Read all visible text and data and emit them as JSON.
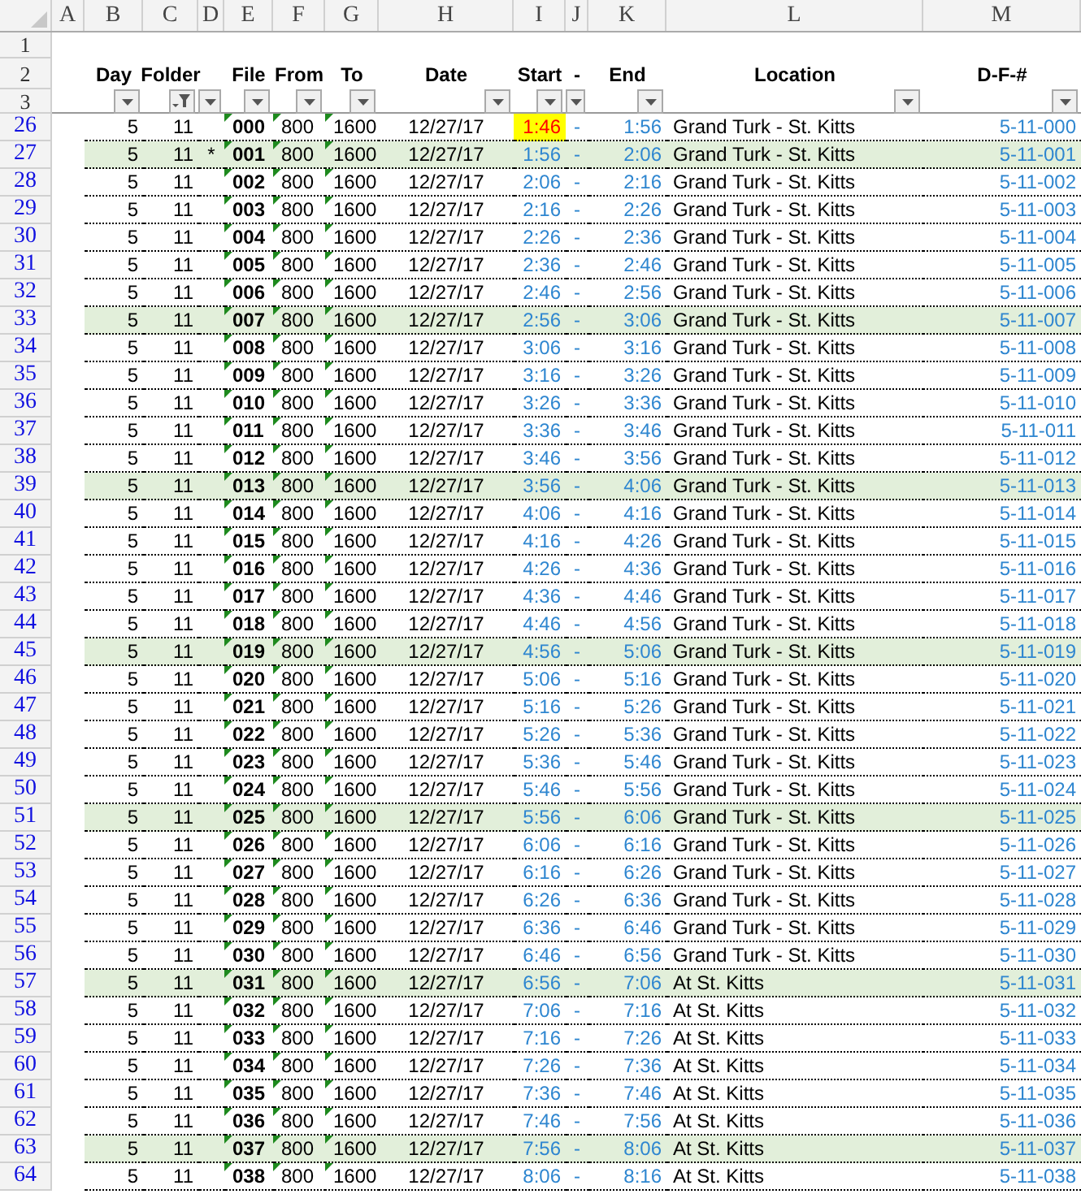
{
  "column_letters": [
    "A",
    "B",
    "C",
    "D",
    "E",
    "F",
    "G",
    "H",
    "I",
    "J",
    "K",
    "L",
    "M"
  ],
  "header_row_numbers": [
    "1",
    "2",
    "3"
  ],
  "headers": [
    {
      "label": "Day",
      "filtered": false
    },
    {
      "label": "Folder",
      "filtered": true
    },
    {
      "filtered": false
    },
    {
      "label": "File",
      "filtered": false
    },
    {
      "label": "From",
      "filtered": false
    },
    {
      "label": "To",
      "filtered": false
    },
    {
      "label": "Date",
      "filtered": false
    },
    {
      "label": "Start",
      "filtered": false
    },
    {
      "label": "-",
      "filtered": false
    },
    {
      "label": "End",
      "filtered": false
    },
    {
      "label": "Location",
      "filtered": false
    },
    {
      "label": "D-F-#",
      "filtered": false
    }
  ],
  "rows": [
    {
      "row": "26",
      "day": "5",
      "folder": "11",
      "file": "000",
      "from": "800",
      "to": "1600",
      "date": "12/27/17",
      "start": "1:46",
      "dash": "-",
      "end": "1:56",
      "location": "Grand Turk - St. Kitts",
      "dfn": "5-11-000",
      "highlighted": false,
      "start_flagged": true
    },
    {
      "row": "27",
      "day": "5",
      "folder": "11",
      "mark": "*",
      "file": "001",
      "from": "800",
      "to": "1600",
      "date": "12/27/17",
      "start": "1:56",
      "dash": "-",
      "end": "2:06",
      "location": "Grand Turk - St. Kitts",
      "dfn": "5-11-001",
      "highlighted": true,
      "start_flagged": false
    },
    {
      "row": "28",
      "day": "5",
      "folder": "11",
      "file": "002",
      "from": "800",
      "to": "1600",
      "date": "12/27/17",
      "start": "2:06",
      "dash": "-",
      "end": "2:16",
      "location": "Grand Turk - St. Kitts",
      "dfn": "5-11-002",
      "highlighted": false,
      "start_flagged": false
    },
    {
      "row": "29",
      "day": "5",
      "folder": "11",
      "file": "003",
      "from": "800",
      "to": "1600",
      "date": "12/27/17",
      "start": "2:16",
      "dash": "-",
      "end": "2:26",
      "location": "Grand Turk - St. Kitts",
      "dfn": "5-11-003",
      "highlighted": false,
      "start_flagged": false
    },
    {
      "row": "30",
      "day": "5",
      "folder": "11",
      "file": "004",
      "from": "800",
      "to": "1600",
      "date": "12/27/17",
      "start": "2:26",
      "dash": "-",
      "end": "2:36",
      "location": "Grand Turk - St. Kitts",
      "dfn": "5-11-004",
      "highlighted": false,
      "start_flagged": false
    },
    {
      "row": "31",
      "day": "5",
      "folder": "11",
      "file": "005",
      "from": "800",
      "to": "1600",
      "date": "12/27/17",
      "start": "2:36",
      "dash": "-",
      "end": "2:46",
      "location": "Grand Turk - St. Kitts",
      "dfn": "5-11-005",
      "highlighted": false,
      "start_flagged": false
    },
    {
      "row": "32",
      "day": "5",
      "folder": "11",
      "file": "006",
      "from": "800",
      "to": "1600",
      "date": "12/27/17",
      "start": "2:46",
      "dash": "-",
      "end": "2:56",
      "location": "Grand Turk - St. Kitts",
      "dfn": "5-11-006",
      "highlighted": false,
      "start_flagged": false
    },
    {
      "row": "33",
      "day": "5",
      "folder": "11",
      "file": "007",
      "from": "800",
      "to": "1600",
      "date": "12/27/17",
      "start": "2:56",
      "dash": "-",
      "end": "3:06",
      "location": "Grand Turk - St. Kitts",
      "dfn": "5-11-007",
      "highlighted": true,
      "start_flagged": false
    },
    {
      "row": "34",
      "day": "5",
      "folder": "11",
      "file": "008",
      "from": "800",
      "to": "1600",
      "date": "12/27/17",
      "start": "3:06",
      "dash": "-",
      "end": "3:16",
      "location": "Grand Turk - St. Kitts",
      "dfn": "5-11-008",
      "highlighted": false,
      "start_flagged": false
    },
    {
      "row": "35",
      "day": "5",
      "folder": "11",
      "file": "009",
      "from": "800",
      "to": "1600",
      "date": "12/27/17",
      "start": "3:16",
      "dash": "-",
      "end": "3:26",
      "location": "Grand Turk - St. Kitts",
      "dfn": "5-11-009",
      "highlighted": false,
      "start_flagged": false
    },
    {
      "row": "36",
      "day": "5",
      "folder": "11",
      "file": "010",
      "from": "800",
      "to": "1600",
      "date": "12/27/17",
      "start": "3:26",
      "dash": "-",
      "end": "3:36",
      "location": "Grand Turk - St. Kitts",
      "dfn": "5-11-010",
      "highlighted": false,
      "start_flagged": false
    },
    {
      "row": "37",
      "day": "5",
      "folder": "11",
      "file": "011",
      "from": "800",
      "to": "1600",
      "date": "12/27/17",
      "start": "3:36",
      "dash": "-",
      "end": "3:46",
      "location": "Grand Turk - St. Kitts",
      "dfn": "5-11-011",
      "highlighted": false,
      "start_flagged": false
    },
    {
      "row": "38",
      "day": "5",
      "folder": "11",
      "file": "012",
      "from": "800",
      "to": "1600",
      "date": "12/27/17",
      "start": "3:46",
      "dash": "-",
      "end": "3:56",
      "location": "Grand Turk - St. Kitts",
      "dfn": "5-11-012",
      "highlighted": false,
      "start_flagged": false
    },
    {
      "row": "39",
      "day": "5",
      "folder": "11",
      "file": "013",
      "from": "800",
      "to": "1600",
      "date": "12/27/17",
      "start": "3:56",
      "dash": "-",
      "end": "4:06",
      "location": "Grand Turk - St. Kitts",
      "dfn": "5-11-013",
      "highlighted": true,
      "start_flagged": false
    },
    {
      "row": "40",
      "day": "5",
      "folder": "11",
      "file": "014",
      "from": "800",
      "to": "1600",
      "date": "12/27/17",
      "start": "4:06",
      "dash": "-",
      "end": "4:16",
      "location": "Grand Turk - St. Kitts",
      "dfn": "5-11-014",
      "highlighted": false,
      "start_flagged": false
    },
    {
      "row": "41",
      "day": "5",
      "folder": "11",
      "file": "015",
      "from": "800",
      "to": "1600",
      "date": "12/27/17",
      "start": "4:16",
      "dash": "-",
      "end": "4:26",
      "location": "Grand Turk - St. Kitts",
      "dfn": "5-11-015",
      "highlighted": false,
      "start_flagged": false
    },
    {
      "row": "42",
      "day": "5",
      "folder": "11",
      "file": "016",
      "from": "800",
      "to": "1600",
      "date": "12/27/17",
      "start": "4:26",
      "dash": "-",
      "end": "4:36",
      "location": "Grand Turk - St. Kitts",
      "dfn": "5-11-016",
      "highlighted": false,
      "start_flagged": false
    },
    {
      "row": "43",
      "day": "5",
      "folder": "11",
      "file": "017",
      "from": "800",
      "to": "1600",
      "date": "12/27/17",
      "start": "4:36",
      "dash": "-",
      "end": "4:46",
      "location": "Grand Turk - St. Kitts",
      "dfn": "5-11-017",
      "highlighted": false,
      "start_flagged": false
    },
    {
      "row": "44",
      "day": "5",
      "folder": "11",
      "file": "018",
      "from": "800",
      "to": "1600",
      "date": "12/27/17",
      "start": "4:46",
      "dash": "-",
      "end": "4:56",
      "location": "Grand Turk - St. Kitts",
      "dfn": "5-11-018",
      "highlighted": false,
      "start_flagged": false
    },
    {
      "row": "45",
      "day": "5",
      "folder": "11",
      "file": "019",
      "from": "800",
      "to": "1600",
      "date": "12/27/17",
      "start": "4:56",
      "dash": "-",
      "end": "5:06",
      "location": "Grand Turk - St. Kitts",
      "dfn": "5-11-019",
      "highlighted": true,
      "start_flagged": false
    },
    {
      "row": "46",
      "day": "5",
      "folder": "11",
      "file": "020",
      "from": "800",
      "to": "1600",
      "date": "12/27/17",
      "start": "5:06",
      "dash": "-",
      "end": "5:16",
      "location": "Grand Turk - St. Kitts",
      "dfn": "5-11-020",
      "highlighted": false,
      "start_flagged": false
    },
    {
      "row": "47",
      "day": "5",
      "folder": "11",
      "file": "021",
      "from": "800",
      "to": "1600",
      "date": "12/27/17",
      "start": "5:16",
      "dash": "-",
      "end": "5:26",
      "location": "Grand Turk - St. Kitts",
      "dfn": "5-11-021",
      "highlighted": false,
      "start_flagged": false
    },
    {
      "row": "48",
      "day": "5",
      "folder": "11",
      "file": "022",
      "from": "800",
      "to": "1600",
      "date": "12/27/17",
      "start": "5:26",
      "dash": "-",
      "end": "5:36",
      "location": "Grand Turk - St. Kitts",
      "dfn": "5-11-022",
      "highlighted": false,
      "start_flagged": false
    },
    {
      "row": "49",
      "day": "5",
      "folder": "11",
      "file": "023",
      "from": "800",
      "to": "1600",
      "date": "12/27/17",
      "start": "5:36",
      "dash": "-",
      "end": "5:46",
      "location": "Grand Turk - St. Kitts",
      "dfn": "5-11-023",
      "highlighted": false,
      "start_flagged": false
    },
    {
      "row": "50",
      "day": "5",
      "folder": "11",
      "file": "024",
      "from": "800",
      "to": "1600",
      "date": "12/27/17",
      "start": "5:46",
      "dash": "-",
      "end": "5:56",
      "location": "Grand Turk - St. Kitts",
      "dfn": "5-11-024",
      "highlighted": false,
      "start_flagged": false
    },
    {
      "row": "51",
      "day": "5",
      "folder": "11",
      "file": "025",
      "from": "800",
      "to": "1600",
      "date": "12/27/17",
      "start": "5:56",
      "dash": "-",
      "end": "6:06",
      "location": "Grand Turk - St. Kitts",
      "dfn": "5-11-025",
      "highlighted": true,
      "start_flagged": false
    },
    {
      "row": "52",
      "day": "5",
      "folder": "11",
      "file": "026",
      "from": "800",
      "to": "1600",
      "date": "12/27/17",
      "start": "6:06",
      "dash": "-",
      "end": "6:16",
      "location": "Grand Turk - St. Kitts",
      "dfn": "5-11-026",
      "highlighted": false,
      "start_flagged": false
    },
    {
      "row": "53",
      "day": "5",
      "folder": "11",
      "file": "027",
      "from": "800",
      "to": "1600",
      "date": "12/27/17",
      "start": "6:16",
      "dash": "-",
      "end": "6:26",
      "location": "Grand Turk - St. Kitts",
      "dfn": "5-11-027",
      "highlighted": false,
      "start_flagged": false
    },
    {
      "row": "54",
      "day": "5",
      "folder": "11",
      "file": "028",
      "from": "800",
      "to": "1600",
      "date": "12/27/17",
      "start": "6:26",
      "dash": "-",
      "end": "6:36",
      "location": "Grand Turk - St. Kitts",
      "dfn": "5-11-028",
      "highlighted": false,
      "start_flagged": false
    },
    {
      "row": "55",
      "day": "5",
      "folder": "11",
      "file": "029",
      "from": "800",
      "to": "1600",
      "date": "12/27/17",
      "start": "6:36",
      "dash": "-",
      "end": "6:46",
      "location": "Grand Turk - St. Kitts",
      "dfn": "5-11-029",
      "highlighted": false,
      "start_flagged": false
    },
    {
      "row": "56",
      "day": "5",
      "folder": "11",
      "file": "030",
      "from": "800",
      "to": "1600",
      "date": "12/27/17",
      "start": "6:46",
      "dash": "-",
      "end": "6:56",
      "location": "Grand Turk - St. Kitts",
      "dfn": "5-11-030",
      "highlighted": false,
      "start_flagged": false
    },
    {
      "row": "57",
      "day": "5",
      "folder": "11",
      "file": "031",
      "from": "800",
      "to": "1600",
      "date": "12/27/17",
      "start": "6:56",
      "dash": "-",
      "end": "7:06",
      "location": "At St. Kitts",
      "dfn": "5-11-031",
      "highlighted": true,
      "start_flagged": false
    },
    {
      "row": "58",
      "day": "5",
      "folder": "11",
      "file": "032",
      "from": "800",
      "to": "1600",
      "date": "12/27/17",
      "start": "7:06",
      "dash": "-",
      "end": "7:16",
      "location": "At St. Kitts",
      "dfn": "5-11-032",
      "highlighted": false,
      "start_flagged": false
    },
    {
      "row": "59",
      "day": "5",
      "folder": "11",
      "file": "033",
      "from": "800",
      "to": "1600",
      "date": "12/27/17",
      "start": "7:16",
      "dash": "-",
      "end": "7:26",
      "location": "At St. Kitts",
      "dfn": "5-11-033",
      "highlighted": false,
      "start_flagged": false
    },
    {
      "row": "60",
      "day": "5",
      "folder": "11",
      "file": "034",
      "from": "800",
      "to": "1600",
      "date": "12/27/17",
      "start": "7:26",
      "dash": "-",
      "end": "7:36",
      "location": "At St. Kitts",
      "dfn": "5-11-034",
      "highlighted": false,
      "start_flagged": false
    },
    {
      "row": "61",
      "day": "5",
      "folder": "11",
      "file": "035",
      "from": "800",
      "to": "1600",
      "date": "12/27/17",
      "start": "7:36",
      "dash": "-",
      "end": "7:46",
      "location": "At St. Kitts",
      "dfn": "5-11-035",
      "highlighted": false,
      "start_flagged": false
    },
    {
      "row": "62",
      "day": "5",
      "folder": "11",
      "file": "036",
      "from": "800",
      "to": "1600",
      "date": "12/27/17",
      "start": "7:46",
      "dash": "-",
      "end": "7:56",
      "location": "At St. Kitts",
      "dfn": "5-11-036",
      "highlighted": false,
      "start_flagged": false
    },
    {
      "row": "63",
      "day": "5",
      "folder": "11",
      "file": "037",
      "from": "800",
      "to": "1600",
      "date": "12/27/17",
      "start": "7:56",
      "dash": "-",
      "end": "8:06",
      "location": "At St. Kitts",
      "dfn": "5-11-037",
      "highlighted": true,
      "start_flagged": false
    },
    {
      "row": "64",
      "day": "5",
      "folder": "11",
      "file": "038",
      "from": "800",
      "to": "1600",
      "date": "12/27/17",
      "start": "8:06",
      "dash": "-",
      "end": "8:16",
      "location": "At St. Kitts",
      "dfn": "5-11-038",
      "highlighted": false,
      "start_flagged": false
    }
  ]
}
